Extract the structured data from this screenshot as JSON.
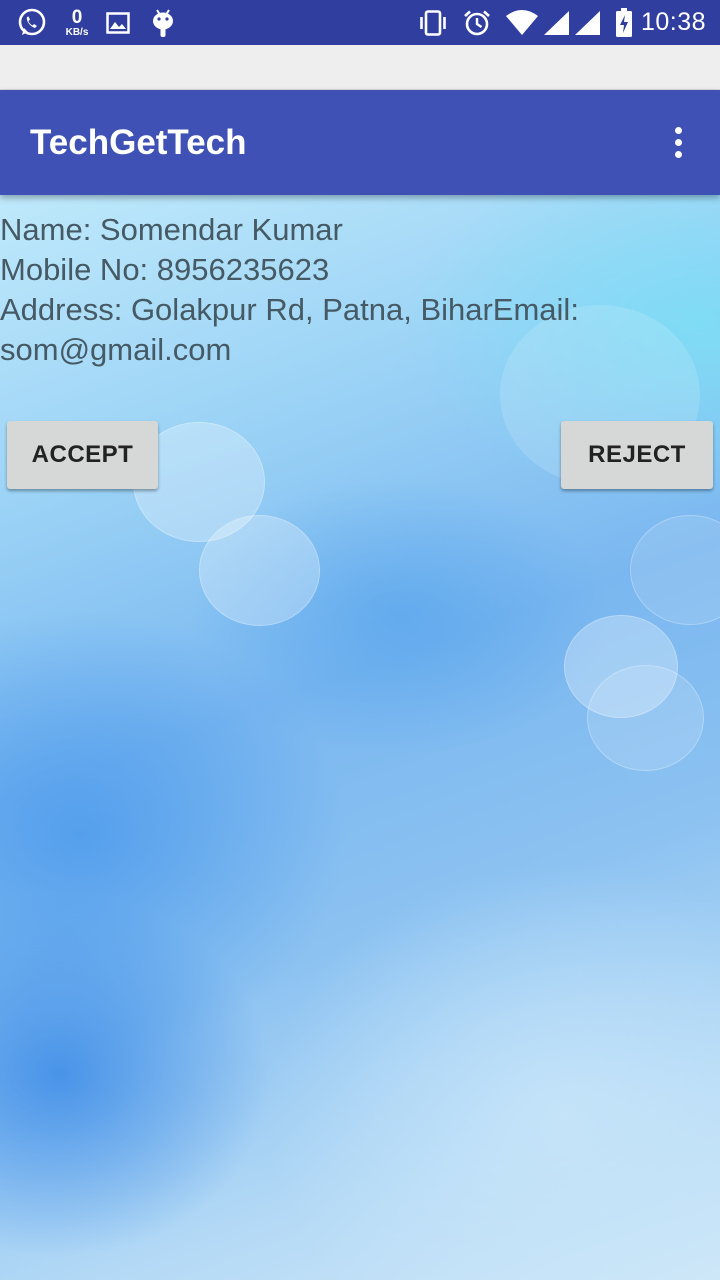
{
  "status_bar": {
    "left_icons": [
      "whatsapp-icon",
      "network-speed-indicator",
      "gallery-icon",
      "android-debug-icon"
    ],
    "network_speed_value": "0",
    "network_speed_unit": "KB/s",
    "right_icons": [
      "vibrate-icon",
      "alarm-icon",
      "wifi-icon",
      "signal-icon",
      "signal-icon",
      "battery-charging-icon"
    ],
    "time": "10:38",
    "background_color": "#303F9F"
  },
  "app_bar": {
    "title": "TechGetTech",
    "menu_icon": "overflow-menu-icon",
    "background_color": "#3F51B5"
  },
  "details": {
    "name": "Name:  Somendar Kumar",
    "mobile": "Mobile No:  8956235623",
    "address_email": "Address: Golakpur Rd, Patna, BiharEmail: som@gmail.com",
    "text_color": "#455A64"
  },
  "actions": {
    "accept_label": "ACCEPT",
    "reject_label": "REJECT"
  }
}
